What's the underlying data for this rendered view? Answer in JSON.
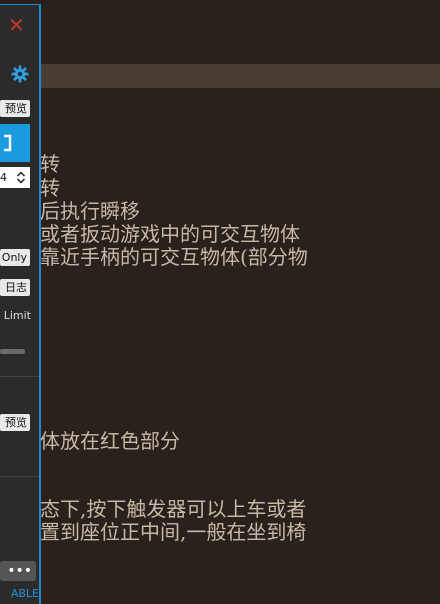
{
  "content": {
    "lines": [
      "则旋转",
      "则旋转",
      " 放开后执行瞬移",
      "拿取或者扳动游戏中的可交互物体",
      "使用靠近手柄的可交互物体(部分物",
      "把物体放在红色部分",
      "的状态下,按下触发器可以上车或者",
      "置重置到座位正中间,一般在坐到椅"
    ]
  },
  "panel": {
    "close_glyph": "✕",
    "preview_label_1": "预览",
    "stepper_value": "4",
    "only_label": "Only",
    "log_label": "日志",
    "limit_label": "Limit",
    "preview_label_2": "预览",
    "more_glyph": "•••",
    "footer_label": "ABLE"
  },
  "colors": {
    "accent": "#1a9be0",
    "close": "#c0392b",
    "text": "#c4b8a6"
  },
  "icons": [
    "close-icon",
    "gear-icon",
    "bracket-icon",
    "chevron-up-icon",
    "chevron-down-icon",
    "more-icon"
  ]
}
